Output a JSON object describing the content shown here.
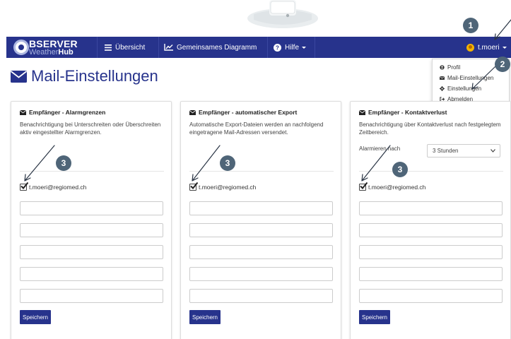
{
  "app": {
    "logo_main": "BSERVER",
    "logo_sub_light": "Weather",
    "logo_sub_bold": "Hub"
  },
  "navbar": {
    "items": [
      {
        "label": "Übersicht",
        "icon": "list-icon"
      },
      {
        "label": "Gemeinsames Diagramm",
        "icon": "line-chart-icon"
      },
      {
        "label": "Hilfe",
        "icon": "help-circle-icon"
      }
    ],
    "user": "t.moeri"
  },
  "user_dropdown": {
    "items": [
      {
        "label": "Profil",
        "icon": "user-circle-icon"
      },
      {
        "label": "Mail-Einstellungen",
        "icon": "envelope-icon"
      },
      {
        "label": "Einstellungen",
        "icon": "gear-icon"
      },
      {
        "label": "Abmelden",
        "icon": "sign-out-icon"
      }
    ]
  },
  "page": {
    "title": "Mail-Einstellungen"
  },
  "panels": [
    {
      "title": "Empfänger - Alarmgrenzen",
      "description": "Benachrichtigung bei Unterschreiten oder Überschreiten aktiv eingestellter Alarmgrenzen.",
      "email": "t.moeri@regiomed.ch",
      "save_label": "Speichern"
    },
    {
      "title": "Empfänger - automatischer Export",
      "description": "Automatische Export-Dateien werden an nachfolgend eingetragene Mail-Adressen versendet.",
      "email": "t.moeri@regiomed.ch",
      "save_label": "Speichern"
    },
    {
      "title": "Empfänger - Kontaktverlust",
      "description": "Benachrichtigung über Kontaktverlust nach festgelegtem Zeitbereich.",
      "alarm_label": "Alarmieren nach",
      "alarm_value": "3 Stunden",
      "email": "t.moeri@regiomed.ch",
      "save_label": "Speichern"
    }
  ],
  "annotations": {
    "badges": [
      "1",
      "2",
      "3",
      "3",
      "3"
    ]
  },
  "colors": {
    "navbar": "#27338c",
    "accent": "#27338c",
    "badge": "#4f6578",
    "user_icon": "#f4b400"
  }
}
